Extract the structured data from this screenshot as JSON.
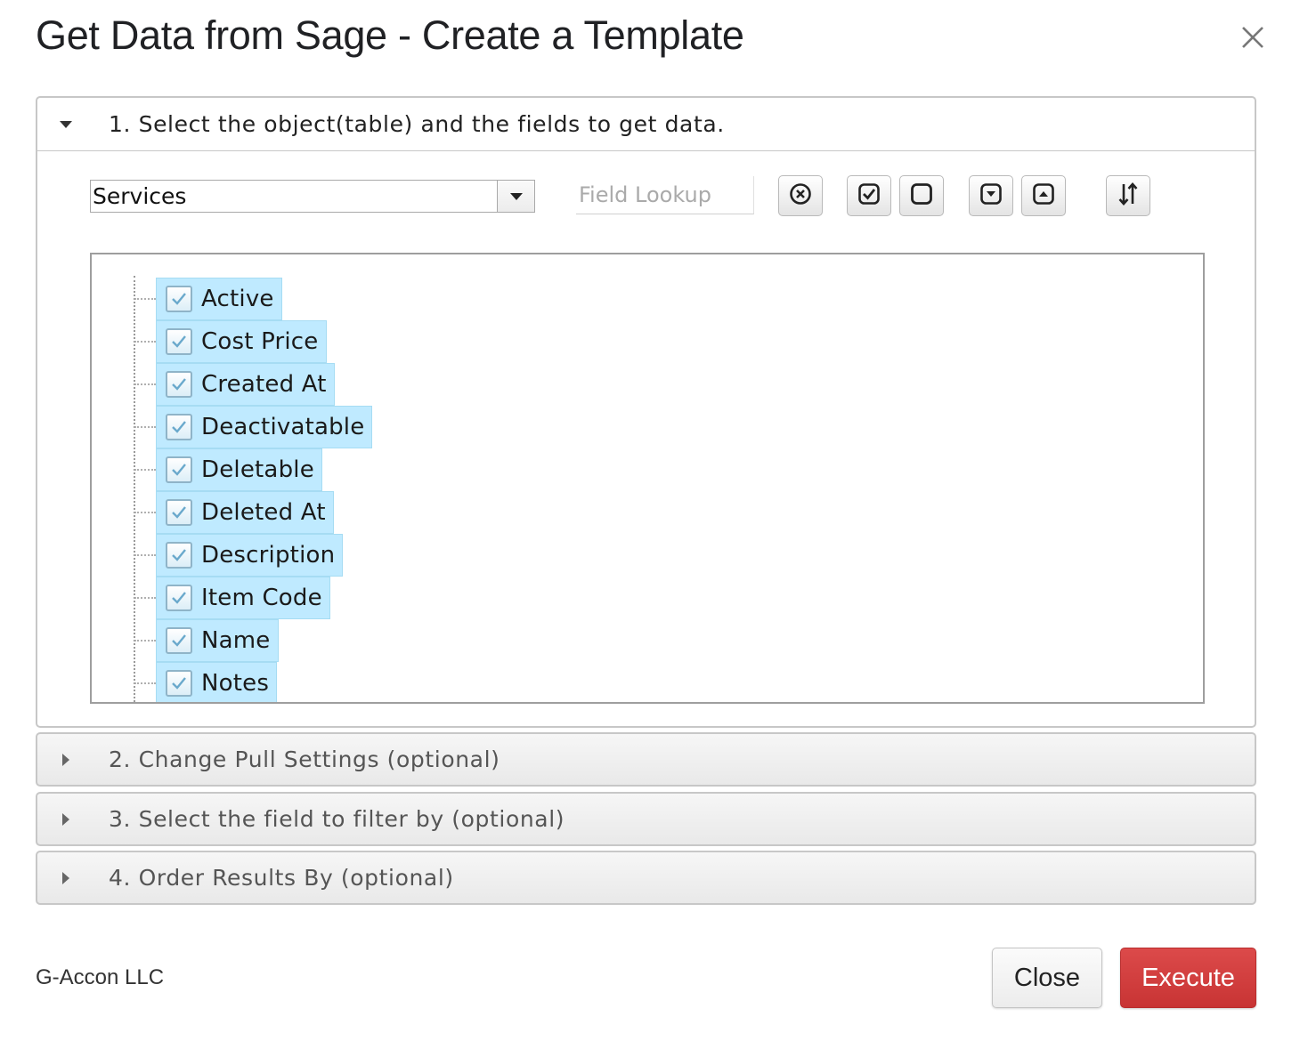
{
  "dialog": {
    "title": "Get Data from Sage - Create a Template"
  },
  "sections": [
    {
      "label": "1. Select the object(table) and the fields to get data.",
      "expanded": true
    },
    {
      "label": "2. Change Pull Settings (optional)",
      "expanded": false
    },
    {
      "label": "3. Select the field to filter by (optional)",
      "expanded": false
    },
    {
      "label": "4. Order Results By (optional)",
      "expanded": false
    }
  ],
  "object_select": {
    "selected": "Services"
  },
  "field_lookup": {
    "placeholder": "Field Lookup",
    "value": ""
  },
  "toolbar": {
    "icons": [
      "clear-icon",
      "check-all-icon",
      "uncheck-all-icon",
      "expand-icon",
      "collapse-icon",
      "sort-icon"
    ]
  },
  "fields": [
    {
      "label": "Active",
      "checked": true
    },
    {
      "label": "Cost Price",
      "checked": true
    },
    {
      "label": "Created At",
      "checked": true
    },
    {
      "label": "Deactivatable",
      "checked": true
    },
    {
      "label": "Deletable",
      "checked": true
    },
    {
      "label": "Deleted At",
      "checked": true
    },
    {
      "label": "Description",
      "checked": true
    },
    {
      "label": "Item Code",
      "checked": true
    },
    {
      "label": "Name",
      "checked": true
    },
    {
      "label": "Notes",
      "checked": true
    }
  ],
  "footer": {
    "company": "G-Accon LLC",
    "close_label": "Close",
    "execute_label": "Execute"
  },
  "colors": {
    "execute": "#cf3b3b",
    "selected_node": "#bfeaff"
  }
}
